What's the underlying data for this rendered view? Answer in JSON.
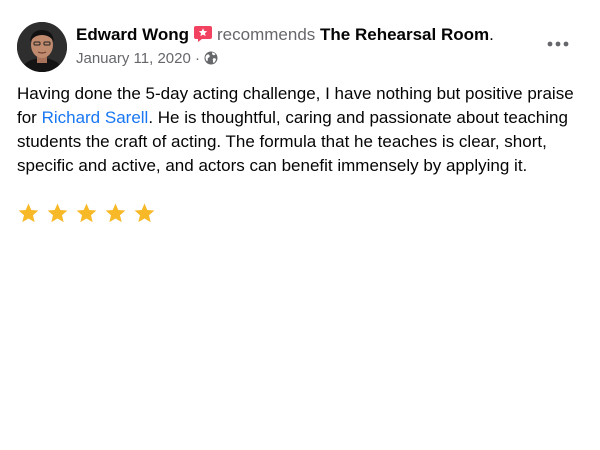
{
  "post": {
    "author": "Edward Wong",
    "verb": "recommends",
    "page_name": "The Rehearsal Room",
    "date": "January 11, 2020",
    "separator": " · ",
    "privacy_icon": "globe-icon",
    "more_icon": "more-options-icon",
    "body": {
      "part1": "Having done the 5-day acting challenge, I have nothing but positive praise for ",
      "mention": "Richard Sarell",
      "part2": ".  He is thoughtful, caring and passionate about teaching students the craft of acting.  The formula that he teaches is clear, short, specific and active, and actors can benefit immensely by applying it."
    },
    "rating": {
      "stars": 5,
      "max": 5,
      "color": "#f7b928"
    },
    "colors": {
      "mention": "#1877f2",
      "secondary_text": "#65676b",
      "badge": "#f3425f"
    }
  }
}
